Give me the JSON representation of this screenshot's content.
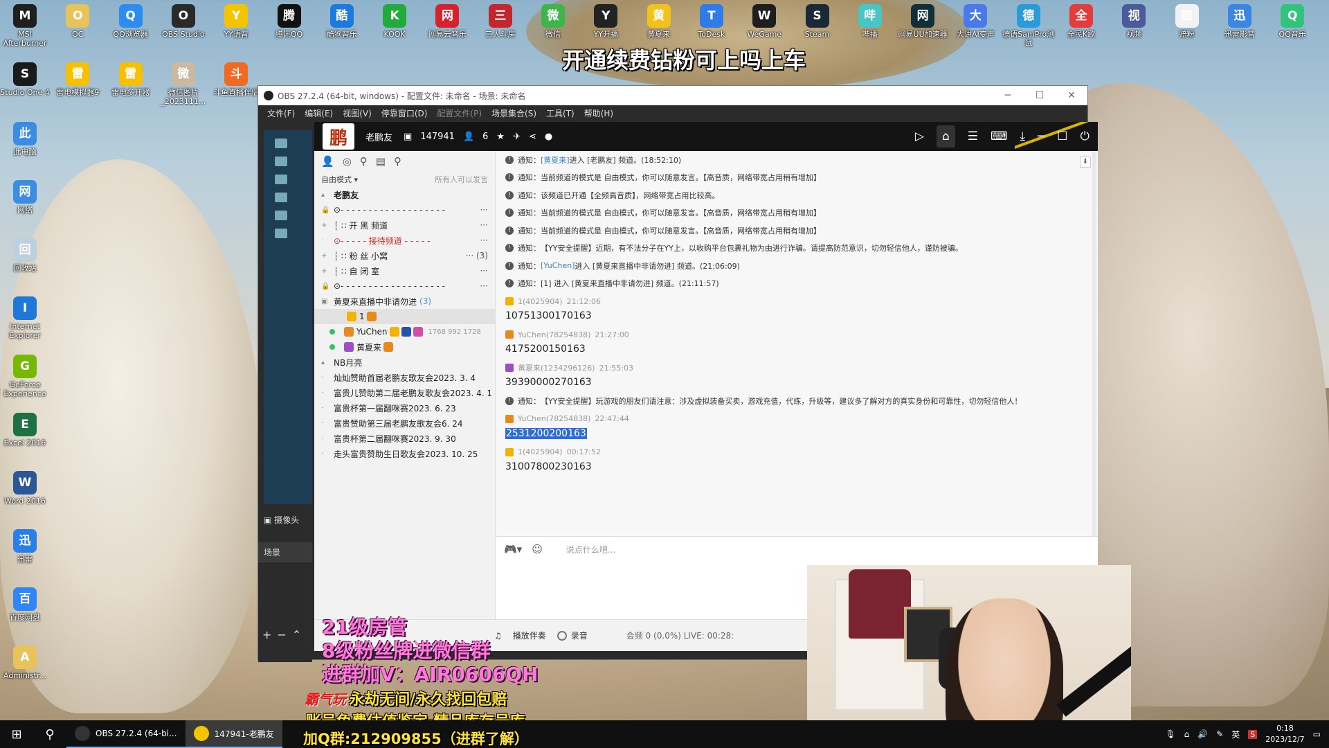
{
  "desktop_icons": [
    {
      "label": "MSI Afterburner",
      "icon": "msi-icon",
      "color": "#1f1f1f"
    },
    {
      "label": "OC",
      "icon": "folder-icon",
      "color": "#e8c35a"
    },
    {
      "label": "QQ浏览器",
      "icon": "qq-browser-icon",
      "color": "#2d8cf0"
    },
    {
      "label": "OBS Studio",
      "icon": "obs-icon",
      "color": "#2a2a2a"
    },
    {
      "label": "YY语音",
      "icon": "yy-icon",
      "color": "#f5c400"
    },
    {
      "label": "腾讯QQ",
      "icon": "qq-icon",
      "color": "#111111"
    },
    {
      "label": "酷狗音乐",
      "icon": "kugou-icon",
      "color": "#1b79e0"
    },
    {
      "label": "KOOK",
      "icon": "kook-icon",
      "color": "#22aa3a"
    },
    {
      "label": "网易云音乐",
      "icon": "netease-music-icon",
      "color": "#d8222b"
    },
    {
      "label": "三人斗房",
      "icon": "game-icon",
      "color": "#c1272d"
    },
    {
      "label": "微信",
      "icon": "wechat-icon",
      "color": "#3fb44a"
    },
    {
      "label": "YY开播",
      "icon": "yy-live-icon",
      "color": "#222222"
    },
    {
      "label": "黄夏来",
      "icon": "star-icon",
      "color": "#f2c21a"
    },
    {
      "label": "ToDesk",
      "icon": "todesk-icon",
      "color": "#2f7be8"
    },
    {
      "label": "WeGame",
      "icon": "wegame-icon",
      "color": "#1e1e1e"
    },
    {
      "label": "Steam",
      "icon": "steam-icon",
      "color": "#1b2838"
    },
    {
      "label": "哔播",
      "icon": "bibo-icon",
      "color": "#48c6c3"
    },
    {
      "label": "网易UU加速器",
      "icon": "uu-icon",
      "color": "#0f2f3a"
    },
    {
      "label": "大讲AI变声",
      "icon": "ai-voice-icon",
      "color": "#4a7ae8"
    },
    {
      "label": "德语SamPro测试",
      "icon": "sampro-icon",
      "color": "#2a9ad8"
    },
    {
      "label": "全民K歌",
      "icon": "ksong-icon",
      "color": "#e43b3b"
    },
    {
      "label": "视频",
      "icon": "video-icon",
      "color": "#4a5a9a"
    },
    {
      "label": "赔粉",
      "icon": "document-icon",
      "color": "#f2f2f2"
    },
    {
      "label": "迅雷影音",
      "icon": "xunlei-player-icon",
      "color": "#3a86e0"
    },
    {
      "label": "QQ音乐",
      "icon": "qq-music-icon",
      "color": "#31c27c"
    },
    {
      "label": "Studio One 4",
      "icon": "studio-one-icon",
      "color": "#1a1a1a"
    },
    {
      "label": "雷电模拟器9",
      "icon": "ldplayer-icon",
      "color": "#f5c000"
    },
    {
      "label": "雷电多开器",
      "icon": "ldmulti-icon",
      "color": "#f5c000"
    },
    {
      "label": "微信图片_2023111...",
      "icon": "image-file-icon",
      "color": "#c9b9a0"
    },
    {
      "label": "斗鱼直播伴侣",
      "icon": "douyu-icon",
      "color": "#f06a24"
    },
    {
      "label": "此电脑",
      "icon": "computer-icon",
      "color": "#3a8de0"
    },
    {
      "label": "网络",
      "icon": "network-icon",
      "color": "#3a8de0"
    },
    {
      "label": "回收站",
      "icon": "recycle-bin-icon",
      "color": "#bcd0e0"
    },
    {
      "label": "Internet Explorer",
      "icon": "ie-icon",
      "color": "#1e78d7"
    },
    {
      "label": "GeForce Experience",
      "icon": "nvidia-icon",
      "color": "#76b900"
    },
    {
      "label": "Excel 2016",
      "icon": "excel-icon",
      "color": "#1e7145"
    },
    {
      "label": "Word 2016",
      "icon": "word-icon",
      "color": "#2b579a"
    },
    {
      "label": "迅雷",
      "icon": "xunlei-icon",
      "color": "#2a7fe6"
    },
    {
      "label": "百度网盘",
      "icon": "baidu-pan-icon",
      "color": "#2f86f6"
    },
    {
      "label": "Administr...",
      "icon": "user-folder-icon",
      "color": "#e8c35a"
    }
  ],
  "top_overlay": "开通续费钻粉可上吗上车",
  "obs": {
    "title": "OBS 27.2.4 (64-bit, windows) - 配置文件: 未命名 - 场景: 未命名",
    "menu": [
      "文件(F)",
      "编辑(E)",
      "视图(V)",
      "停靠窗口(D)",
      "配置文件(P)",
      "场景集合(S)",
      "工具(T)",
      "帮助(H)"
    ],
    "camera_label": "摄像头",
    "scene_label": "场景"
  },
  "yy": {
    "logo_char": "鹏",
    "channel_name": "老鹏友",
    "channel_id": "147941",
    "online_count": "6",
    "mode": "自由模式 ▾",
    "mode_note": "所有人可以发言",
    "tree": [
      {
        "pre": "▴",
        "text": "老鹏友",
        "style": "bold",
        "dots": ""
      },
      {
        "pre": "🔒",
        "text": "⊙- - - - - - - - - - - - - - - - - - -",
        "style": "",
        "dots": "···"
      },
      {
        "pre": "+",
        "text": "┆  ∷        开  黑    频道",
        "style": "",
        "dots": "···"
      },
      {
        "pre": "·",
        "text": "⊙- - - - - 接待频道 - - - - -",
        "style": "red",
        "dots": "···"
      },
      {
        "pre": "+",
        "text": "┆  ∷        粉  丝    小窝",
        "style": "",
        "dots": "··· (3)"
      },
      {
        "pre": "+",
        "text": "┆  ∷           自  闭  室",
        "style": "",
        "dots": "···"
      },
      {
        "pre": "🔒",
        "text": "⊙- - - - - - - - - - - - - - - - - - -",
        "style": "",
        "dots": "···"
      }
    ],
    "live_channel": {
      "name": "黄夏来直播中非请勿进",
      "count": "(3)"
    },
    "users": [
      {
        "name": "1",
        "badges": [
          "b-y",
          "b-o"
        ],
        "nums": "",
        "selected": true
      },
      {
        "name": "YuChen",
        "badges": [
          "b-o",
          "b-y",
          "b-b",
          "b-k"
        ],
        "nums": "1768  992  1728",
        "selected": false
      },
      {
        "name": "黄夏来",
        "badges": [
          "b-p",
          "b-o"
        ],
        "nums": "",
        "selected": false
      }
    ],
    "sub_channels": [
      "NB月亮",
      "灿灿赞助首届老鹏友歌友会2023. 3. 4",
      "富贵儿赞助第二届老鹏友歌友会2023. 4. 1",
      "富贵杯第一届翻咪赛2023. 6. 23",
      "富贵赞助第三届老鹏友歌友会6. 24",
      "富贵杯第二届翻咪赛2023. 9. 30",
      "走头富贵赞助生日歌友会2023. 10. 25"
    ],
    "chat": [
      {
        "type": "notice",
        "prefix": "通知：",
        "hl": "[黄夏来]",
        "text": " 进入 [老鹏友] 频道。(18:52:10)"
      },
      {
        "type": "notice",
        "prefix": "通知：",
        "hl": "",
        "text": "当前频道的模式是 自由模式，你可以随意发言。【高音质，网络带宽占用稍有增加】"
      },
      {
        "type": "notice",
        "prefix": "通知：",
        "hl": "",
        "text": "该频道已开通【全频高音质】，网络带宽占用比较高。"
      },
      {
        "type": "notice",
        "prefix": "通知：",
        "hl": "",
        "text": "当前频道的模式是 自由模式，你可以随意发言。【高音质，网络带宽占用稍有增加】"
      },
      {
        "type": "notice",
        "prefix": "通知：",
        "hl": "",
        "text": "当前频道的模式是 自由模式，你可以随意发言。【高音质，网络带宽占用稍有增加】"
      },
      {
        "type": "notice",
        "prefix": "通知：",
        "hl": "",
        "text": "【YY安全提醒】近期，有不法分子在YY上，以收购平台包裹礼物为由进行诈骗。请提高防范意识，切勿轻信他人，谨防被骗。"
      },
      {
        "type": "notice",
        "prefix": "通知：",
        "hl": "[YuChen]",
        "text": " 进入 [黄夏来直播中非请勿进] 频道。(21:06:09)"
      },
      {
        "type": "notice",
        "prefix": "通知：",
        "hl": "",
        "text": "[1] 进入 [黄夏来直播中非请勿进] 频道。(21:11:57)"
      },
      {
        "type": "user",
        "user": "1(4025904)",
        "time": "21:12:06",
        "gift": "b-y",
        "body": "10751300170163",
        "selected": false
      },
      {
        "type": "user",
        "user": "YuChen(78254838)",
        "time": "21:27:00",
        "gift": "b-o",
        "body": "4175200150163",
        "selected": false
      },
      {
        "type": "user",
        "user": "黄夏来(1234296126)",
        "time": "21:55:03",
        "gift": "b-p",
        "body": "39390000270163",
        "selected": false
      },
      {
        "type": "notice",
        "prefix": "通知：",
        "hl": "",
        "text": "【YY安全提醒】玩游戏的朋友们请注意：涉及虚拟装备买卖，游戏充值，代练，升级等，建议多了解对方的真实身份和可靠性，切勿轻信他人！"
      },
      {
        "type": "user",
        "user": "YuChen(78254838)",
        "time": "22:47:44",
        "gift": "b-o",
        "body": "2531200200163",
        "selected": true
      },
      {
        "type": "user",
        "user": "1(4025904)",
        "time": "00:17:52",
        "gift": "b-y",
        "body": "31007800230163",
        "selected": false
      }
    ],
    "input_placeholder": "说点什么吧...",
    "bottom": {
      "accompany": "播放伴奏",
      "record": "录音",
      "status": "会频 0 (0.0%)   LIVE: 00:28:"
    }
  },
  "stream_overlay": {
    "line1": "21级房管",
    "line2": "8级粉丝牌进微信群",
    "line3": "进群加V：AIR0606QH",
    "line4_brand": "霸气玩",
    "line4_text": "永劫无间/永久找回包赔",
    "line5": "账号免费估值鉴定·精品库存号库",
    "line6": "加Q群:212909855（进群了解）"
  },
  "taskbar": {
    "items": [
      {
        "label": "OBS 27.2.4 (64-bi...",
        "icon": "obs-icon",
        "color": "#333333",
        "active": false
      },
      {
        "label": "147941-老鹏友",
        "icon": "yy-icon",
        "color": "#f5c400",
        "active": true
      }
    ],
    "ime": "英",
    "time": "0:18",
    "date": "2023/12/7"
  }
}
